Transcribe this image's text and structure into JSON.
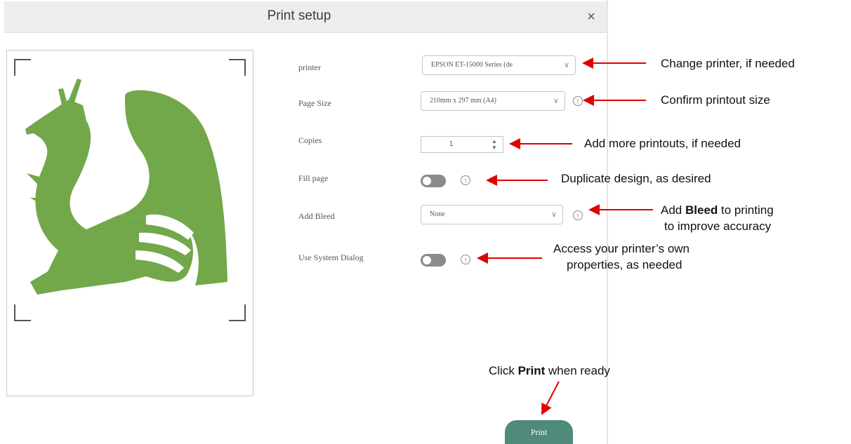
{
  "dialog": {
    "title": "Print setup",
    "close_glyph": "×"
  },
  "fields": {
    "printer_label": "printer",
    "printer_value": "EPSON ET-15000 Series (de",
    "page_size_label": "Page Size",
    "page_size_value": "210mm x 297 mm (A4)",
    "copies_label": "Copies",
    "copies_value": "1",
    "fill_page_label": "Fill page",
    "add_bleed_label": "Add Bleed",
    "add_bleed_value": "None",
    "system_dialog_label": "Use System Dialog"
  },
  "buttons": {
    "print_label": "Print"
  },
  "annotations": {
    "change_printer": "Change  printer,  if needed",
    "confirm_size": "Confirm  printout size",
    "more_printouts": "Add more printouts, if needed",
    "duplicate": "Duplicate design, as desired",
    "bleed_pre": "Add ",
    "bleed_bold": "Bleed",
    "bleed_post": " to printing",
    "bleed_line2": "to improve accuracy",
    "system_line1": "Access your printer’s own",
    "system_line2": "properties, as needed",
    "print_pre": "Click ",
    "print_bold": "Print",
    "print_post": " when ready"
  },
  "colors": {
    "dragon": "#72a84a",
    "print_button": "#4f8a7a",
    "arrow": "#e00000",
    "toggle_off": "#8b8b8b"
  },
  "icons": {
    "close": "close-icon",
    "info": "info-icon",
    "chevron": "chevron-down-icon",
    "spinner": "spinner-arrows-icon"
  }
}
